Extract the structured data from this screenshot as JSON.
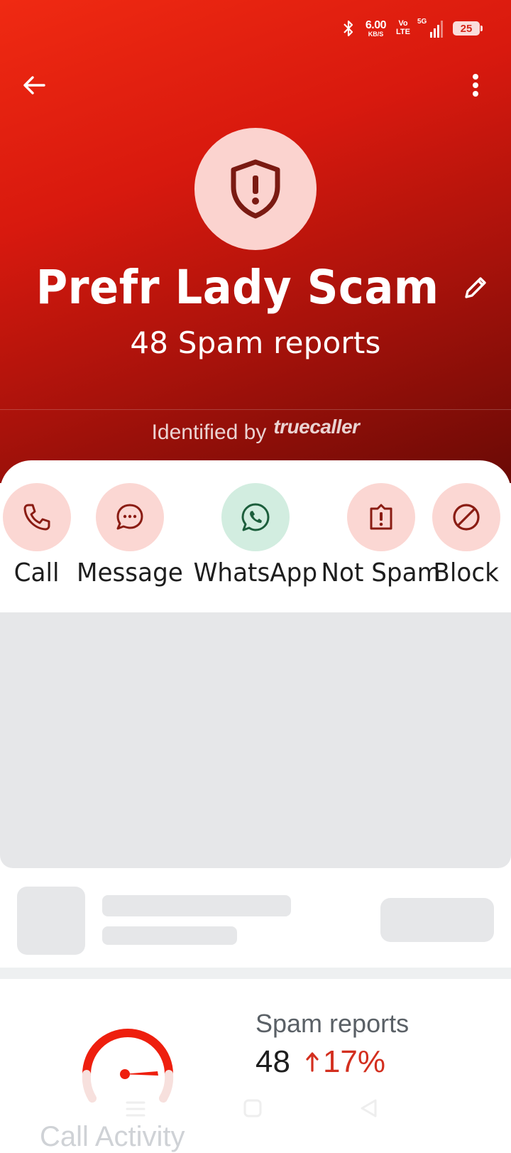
{
  "status_bar": {
    "net_speed": "6.00",
    "net_unit": "KB/S",
    "volte_top": "Vo",
    "volte_bottom": "LTE",
    "network": "5G",
    "battery": "25"
  },
  "header": {
    "contact_name": "Prefr Lady Scam",
    "spam_reports_text": "48 Spam reports",
    "identified_label": "Identified by",
    "brand": "truecaller"
  },
  "actions": [
    {
      "label": "Call",
      "icon": "phone-icon"
    },
    {
      "label": "Message",
      "icon": "message-icon"
    },
    {
      "label": "WhatsApp",
      "icon": "whatsapp-icon"
    },
    {
      "label": "Not Spam",
      "icon": "not-spam-icon"
    },
    {
      "label": "Block",
      "icon": "block-icon"
    }
  ],
  "stats": {
    "title": "Spam reports",
    "value": "48",
    "change": "17%",
    "change_direction": "up"
  },
  "section_peek": "Call Activity",
  "colors": {
    "header_red": "#e01e10",
    "action_bg": "#fbd7d3",
    "whatsapp_bg": "#d2ede0",
    "increase_red": "#d32f1f"
  }
}
